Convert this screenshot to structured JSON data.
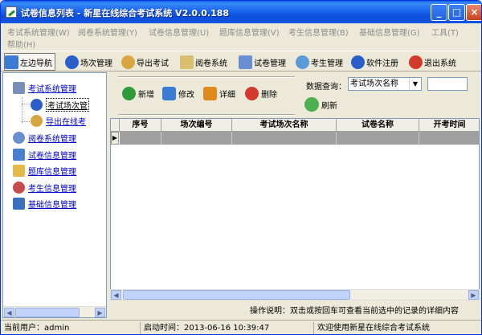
{
  "window": {
    "title": "试卷信息列表 - 新星在线综合考试系统 V2.0.0.188",
    "min_glyph": "_",
    "max_glyph": "□",
    "close_glyph": "×"
  },
  "menu": [
    "考试系统管理(W)",
    "阅卷系统管理(Y)",
    "试卷信息管理(U)",
    "题库信息管理(V)",
    "考生信息管理(B)",
    "基础信息管理(G)",
    "工具(T)",
    "帮助(H)"
  ],
  "toolbar": [
    {
      "label": "左边导航",
      "icon": "left-nav-icon",
      "color": "#3b7bd4"
    },
    {
      "label": "场次管理",
      "icon": "info-icon",
      "color": "#2a5fc9"
    },
    {
      "label": "导出考试",
      "icon": "export-person-icon",
      "color": "#d8a640"
    },
    {
      "label": "阅卷系统",
      "icon": "pencil-paper-icon",
      "color": "#d9c070"
    },
    {
      "label": "试卷管理",
      "icon": "document-icon",
      "color": "#6a8fd0"
    },
    {
      "label": "考生管理",
      "icon": "users-icon",
      "color": "#5a9ad8"
    },
    {
      "label": "软件注册",
      "icon": "info-icon",
      "color": "#2a5fc9"
    },
    {
      "label": "退出系统",
      "icon": "exit-icon",
      "color": "#d33a2c"
    }
  ],
  "tree": [
    {
      "label": "考试系统管理",
      "icon": "exam-system-icon",
      "color": "#7a8fb8"
    },
    {
      "label": "考试场次管",
      "icon": "info-icon",
      "color": "#2a5fc9"
    },
    {
      "label": "导出在线考",
      "icon": "export-person-icon",
      "color": "#d8a640"
    },
    {
      "label": "阅卷系统管理",
      "icon": "magnifier-icon",
      "color": "#6a8fd0"
    },
    {
      "label": "试卷信息管理",
      "icon": "search-document-icon",
      "color": "#4a7fd0"
    },
    {
      "label": "题库信息管理",
      "icon": "folder-icon",
      "color": "#e3b94a"
    },
    {
      "label": "考生信息管理",
      "icon": "users-icon",
      "color": "#c94a4a"
    },
    {
      "label": "基础信息管理",
      "icon": "settings-icon",
      "color": "#3a6fc0"
    }
  ],
  "actions": [
    {
      "label": "新增",
      "icon": "add-icon",
      "color": "#2e9b3a"
    },
    {
      "label": "修改",
      "icon": "edit-icon",
      "color": "#3b7bd4"
    },
    {
      "label": "详细",
      "icon": "detail-search-icon",
      "color": "#e08a1e"
    },
    {
      "label": "删除",
      "icon": "delete-icon",
      "color": "#d33a2c"
    }
  ],
  "query": {
    "label": "数据查询：",
    "selected": "考试场次名称",
    "input_value": "",
    "refresh": "刷新"
  },
  "grid": {
    "columns": [
      "序号",
      "场次编号",
      "考试场次名称",
      "试卷名称",
      "开考时间"
    ],
    "row_indicator": "▶"
  },
  "tip": "操作说明：双击或按回车可查看当前选中的记录的详细内容",
  "status": {
    "user": "当前用户：admin",
    "start_time": "启动时间：2013-06-16 10:39:47",
    "welcome": "欢迎使用新星在线综合考试系统"
  }
}
